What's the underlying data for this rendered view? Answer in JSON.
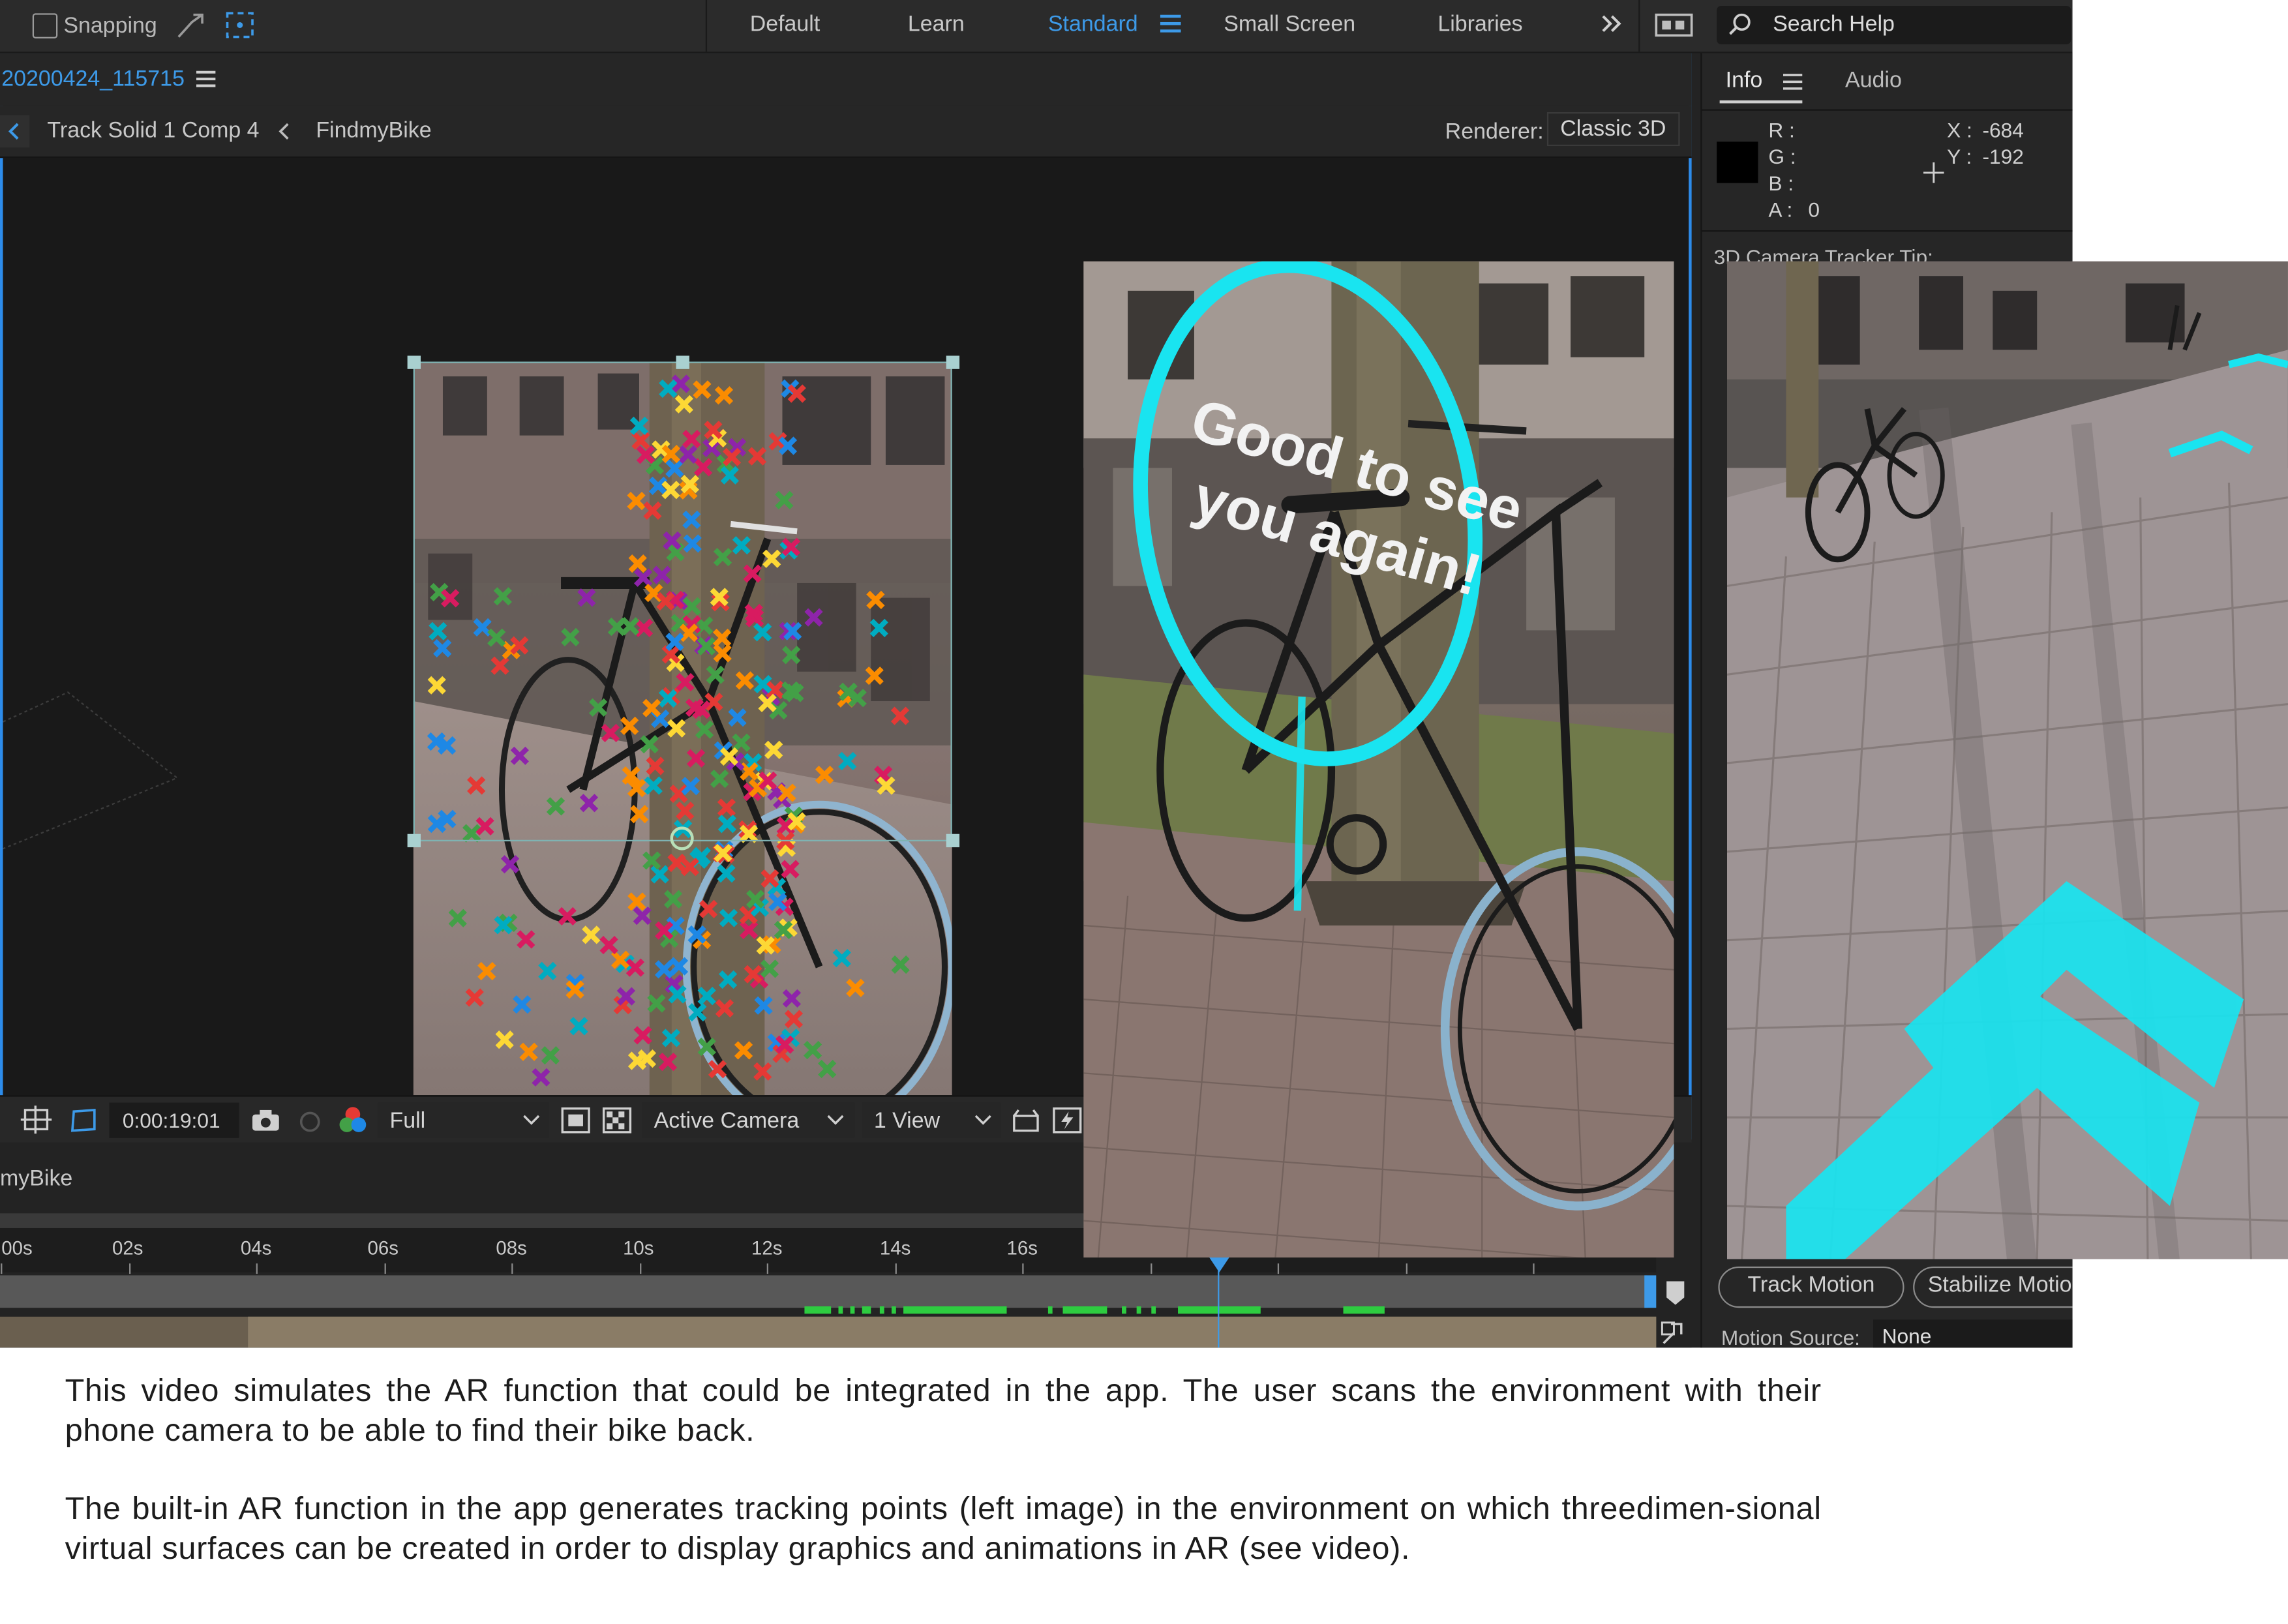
{
  "topbar": {
    "snapping_label": "Snapping",
    "workspaces": [
      "Default",
      "Learn",
      "Standard",
      "Small Screen",
      "Libraries"
    ],
    "active_workspace": "Standard",
    "search_placeholder": "Search Help"
  },
  "composition": {
    "tab_name": "20200424_115715",
    "breadcrumb": [
      "Track Solid 1 Comp 4",
      "FindmyBike"
    ],
    "renderer_label": "Renderer:",
    "renderer_value": "Classic 3D"
  },
  "viewer_bar": {
    "timecode": "0:00:19:01",
    "resolution": "Full",
    "camera": "Active Camera",
    "views": "1 View"
  },
  "timeline": {
    "comp_name": "myBike",
    "ticks": [
      "00s",
      "02s",
      "04s",
      "06s",
      "08s",
      "10s",
      "12s",
      "14s",
      "16s"
    ]
  },
  "info_panel": {
    "tabs": [
      "Info",
      "Audio"
    ],
    "active_tab": "Info",
    "r_label": "R :",
    "g_label": "G :",
    "b_label": "B :",
    "a_label": "A :",
    "a_value": "0",
    "x_label": "X :",
    "x_value": "-684",
    "y_label": "Y :",
    "y_value": "-192",
    "tip_text": "3D Camera Tracker Tip:",
    "track_motion": "Track Motion",
    "stabilize_motion": "Stabilize Motio",
    "motion_source_label": "Motion Source:",
    "motion_source_value": "None"
  },
  "ar_overlay": {
    "message_line1": "Good to see",
    "message_line2": "you again!"
  },
  "caption": {
    "paragraph1": "This video simulates the AR function that could be integrated in the app. The user scans the environment with their phone camera to be able to find their bike back.",
    "paragraph2": "The built-in AR function in the app generates tracking points (left image) in the environment on which threedimen-sional virtual surfaces can be created in order to display graphics and animations in AR (see video)."
  },
  "colors": {
    "accent": "#2d8ceb",
    "ar_cyan": "#19e4f0",
    "panel_bg": "#232323"
  }
}
